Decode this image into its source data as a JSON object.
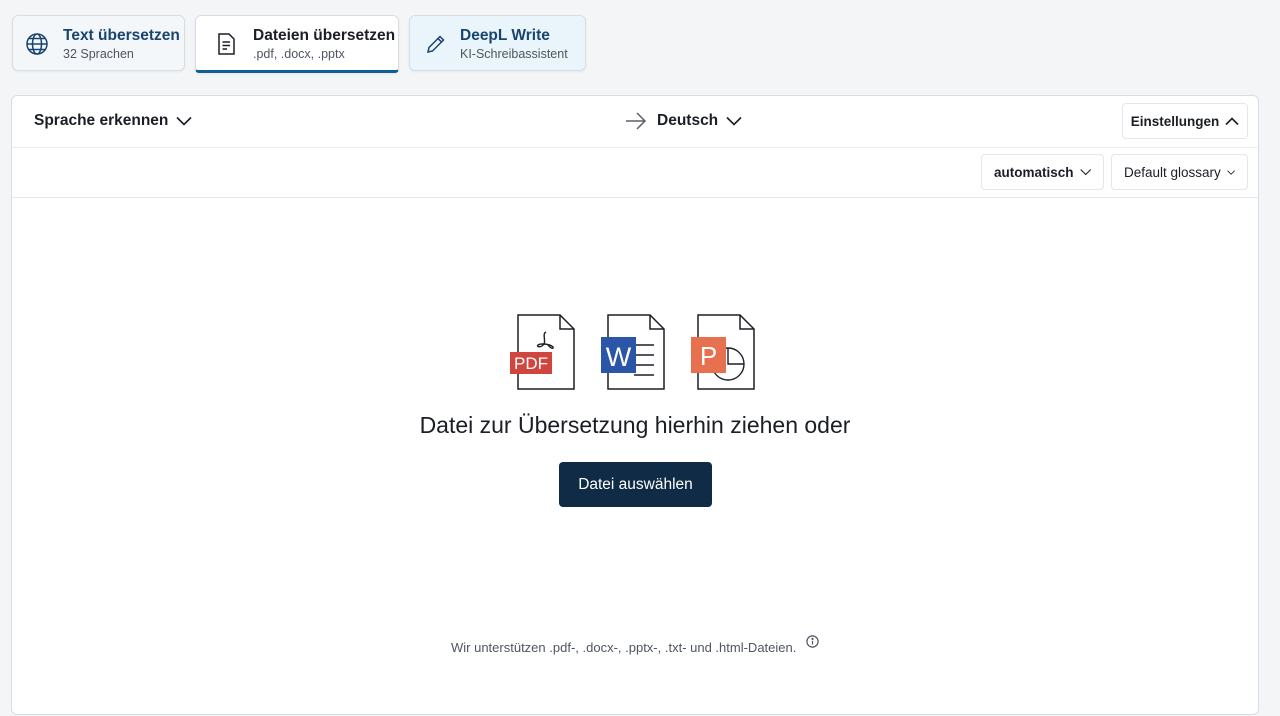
{
  "tabs": [
    {
      "title": "Text übersetzen",
      "subtitle": "32 Sprachen",
      "icon": "globe-icon"
    },
    {
      "title": "Dateien übersetzen",
      "subtitle": ".pdf, .docx, .pptx",
      "icon": "document-icon"
    },
    {
      "title": "DeepL Write",
      "subtitle": "KI-Schreibassistent",
      "icon": "pencil-icon"
    }
  ],
  "langbar": {
    "source_language": "Sprache erkennen",
    "target_language": "Deutsch",
    "settings_label": "Einstellungen"
  },
  "options": {
    "formality": "automatisch",
    "glossary": "Default glossary"
  },
  "dropzone": {
    "prompt": "Datei zur Übersetzung hierhin ziehen oder",
    "button_label": "Datei auswählen",
    "supported_note": "Wir unterstützen .pdf-, .docx-, .pptx-, .txt- und .html-Dateien.",
    "file_badges": {
      "pdf": "PDF",
      "word": "W",
      "powerpoint": "P"
    }
  },
  "colors": {
    "accent": "#0f5e95",
    "button": "#0f2b46",
    "pdf": "#d0463f",
    "word": "#2b55a6",
    "powerpoint": "#e7714e"
  }
}
